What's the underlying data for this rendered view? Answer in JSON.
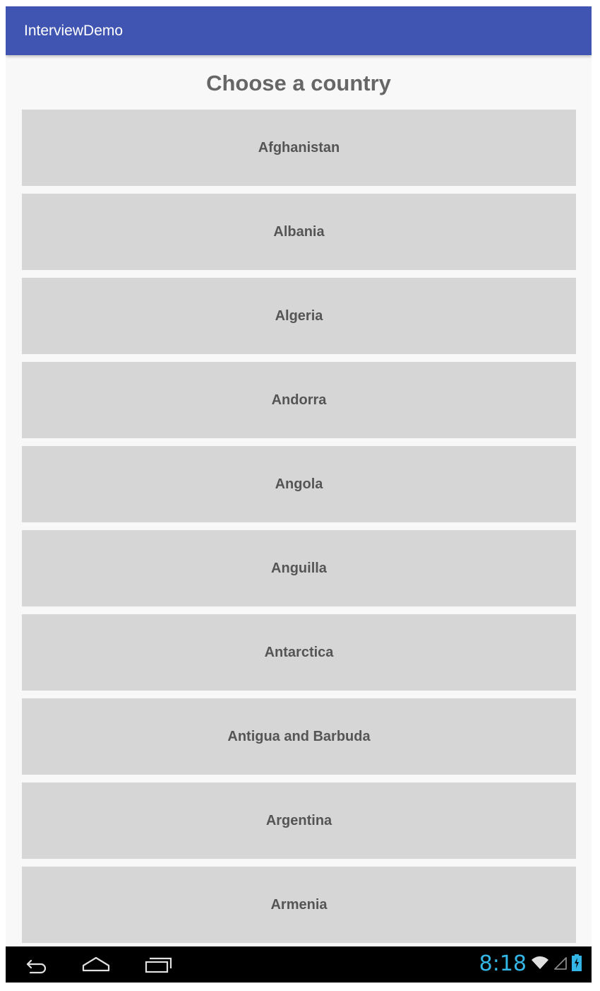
{
  "app": {
    "title": "InterviewDemo"
  },
  "main": {
    "heading": "Choose a country",
    "countries": [
      "Afghanistan",
      "Albania",
      "Algeria",
      "Andorra",
      "Angola",
      "Anguilla",
      "Antarctica",
      "Antigua and Barbuda",
      "Argentina",
      "Armenia"
    ]
  },
  "system": {
    "time": "8:18",
    "icons": [
      "back-icon",
      "home-icon",
      "recents-icon",
      "wifi-icon",
      "signal-icon",
      "battery-charging-icon"
    ]
  },
  "colors": {
    "app_bar": "#4054b2",
    "button_bg": "#d6d6d6",
    "clock": "#33b5e5"
  }
}
